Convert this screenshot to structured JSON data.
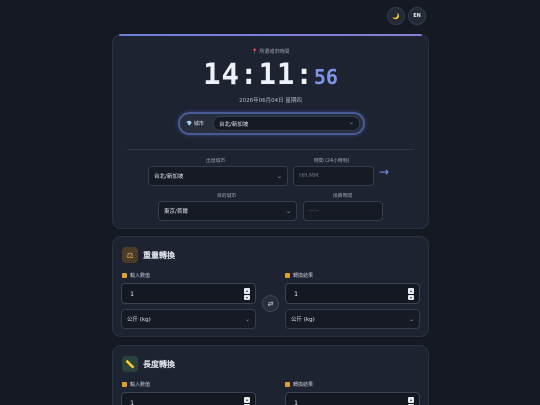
{
  "topbar": {
    "theme_icon": "moon-icon",
    "lang_label": "EN"
  },
  "clock": {
    "location_label": "📍 所選城市時間",
    "time_hm": "14:11:",
    "time_s": "56",
    "date": "2026年06月04日 星期四"
  },
  "city_select": {
    "label": "💎 城市",
    "value": "台北/新加坡"
  },
  "converter": {
    "from_label": "出發城市",
    "from_value": "台北/新加坡",
    "time_label": "時間 (24小時制)",
    "time_placeholder": "HH:MM",
    "to_label": "目的城市",
    "to_value": "東京/首爾",
    "result_label": "換算時間",
    "result_placeholder": "--:--"
  },
  "weight": {
    "title": "重量轉換",
    "icon": "scale-icon",
    "input_label": "輸入數值",
    "output_label": "轉換結果",
    "input_value": "1",
    "output_value": "1",
    "from_unit": "公斤 (kg)",
    "to_unit": "公斤 (kg)"
  },
  "length": {
    "title": "長度轉換",
    "icon": "ruler-icon",
    "input_label": "輸入數值",
    "output_label": "轉換結果",
    "input_value": "1",
    "output_value": "1"
  },
  "colors": {
    "accent": "#6d82d6",
    "seconds": "#7c95e6",
    "arrow": "#7b96ea"
  }
}
